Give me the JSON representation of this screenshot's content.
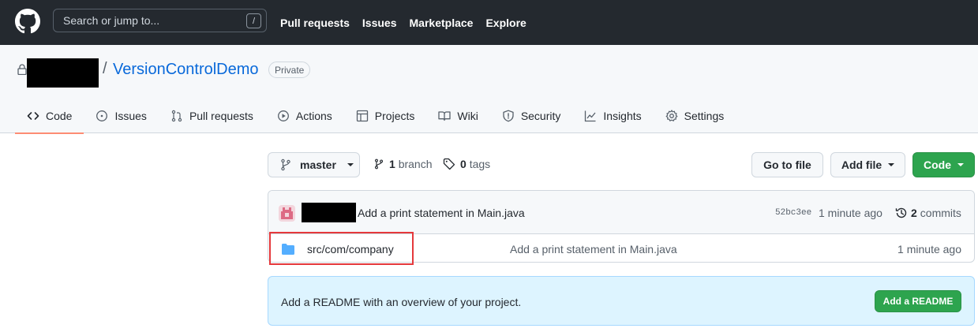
{
  "header": {
    "search_placeholder": "Search or jump to...",
    "slash_key": "/",
    "nav": [
      "Pull requests",
      "Issues",
      "Marketplace",
      "Explore"
    ]
  },
  "repo": {
    "separator": "/",
    "name": "VersionControlDemo",
    "visibility": "Private"
  },
  "tabs": [
    {
      "label": "Code",
      "icon": "code-icon"
    },
    {
      "label": "Issues",
      "icon": "issue-opened-icon"
    },
    {
      "label": "Pull requests",
      "icon": "git-pull-request-icon"
    },
    {
      "label": "Actions",
      "icon": "play-icon"
    },
    {
      "label": "Projects",
      "icon": "table-icon"
    },
    {
      "label": "Wiki",
      "icon": "book-icon"
    },
    {
      "label": "Security",
      "icon": "shield-icon"
    },
    {
      "label": "Insights",
      "icon": "graph-icon"
    },
    {
      "label": "Settings",
      "icon": "gear-icon"
    }
  ],
  "toolbar": {
    "branch": "master",
    "branch_count": "1",
    "branch_word": "branch",
    "tag_count": "0",
    "tag_word": "tags",
    "go_to_file": "Go to file",
    "add_file": "Add file",
    "code": "Code"
  },
  "latest_commit": {
    "message": "Add a print statement in Main.java",
    "sha": "52bc3ee",
    "time": "1 minute ago",
    "count": "2",
    "count_word": "commits"
  },
  "files": [
    {
      "name": "src/com/company",
      "commit": "Add a print statement in Main.java",
      "time": "1 minute ago",
      "type": "folder"
    }
  ],
  "readme": {
    "text": "Add a README with an overview of your project.",
    "button": "Add a README"
  },
  "colors": {
    "header_bg": "#24292f",
    "link_blue": "#0969da",
    "green_button": "#2da44e",
    "active_tab_underline": "#fd8c73",
    "highlight_red": "#e5393c",
    "readme_bg": "#ddf4ff"
  }
}
